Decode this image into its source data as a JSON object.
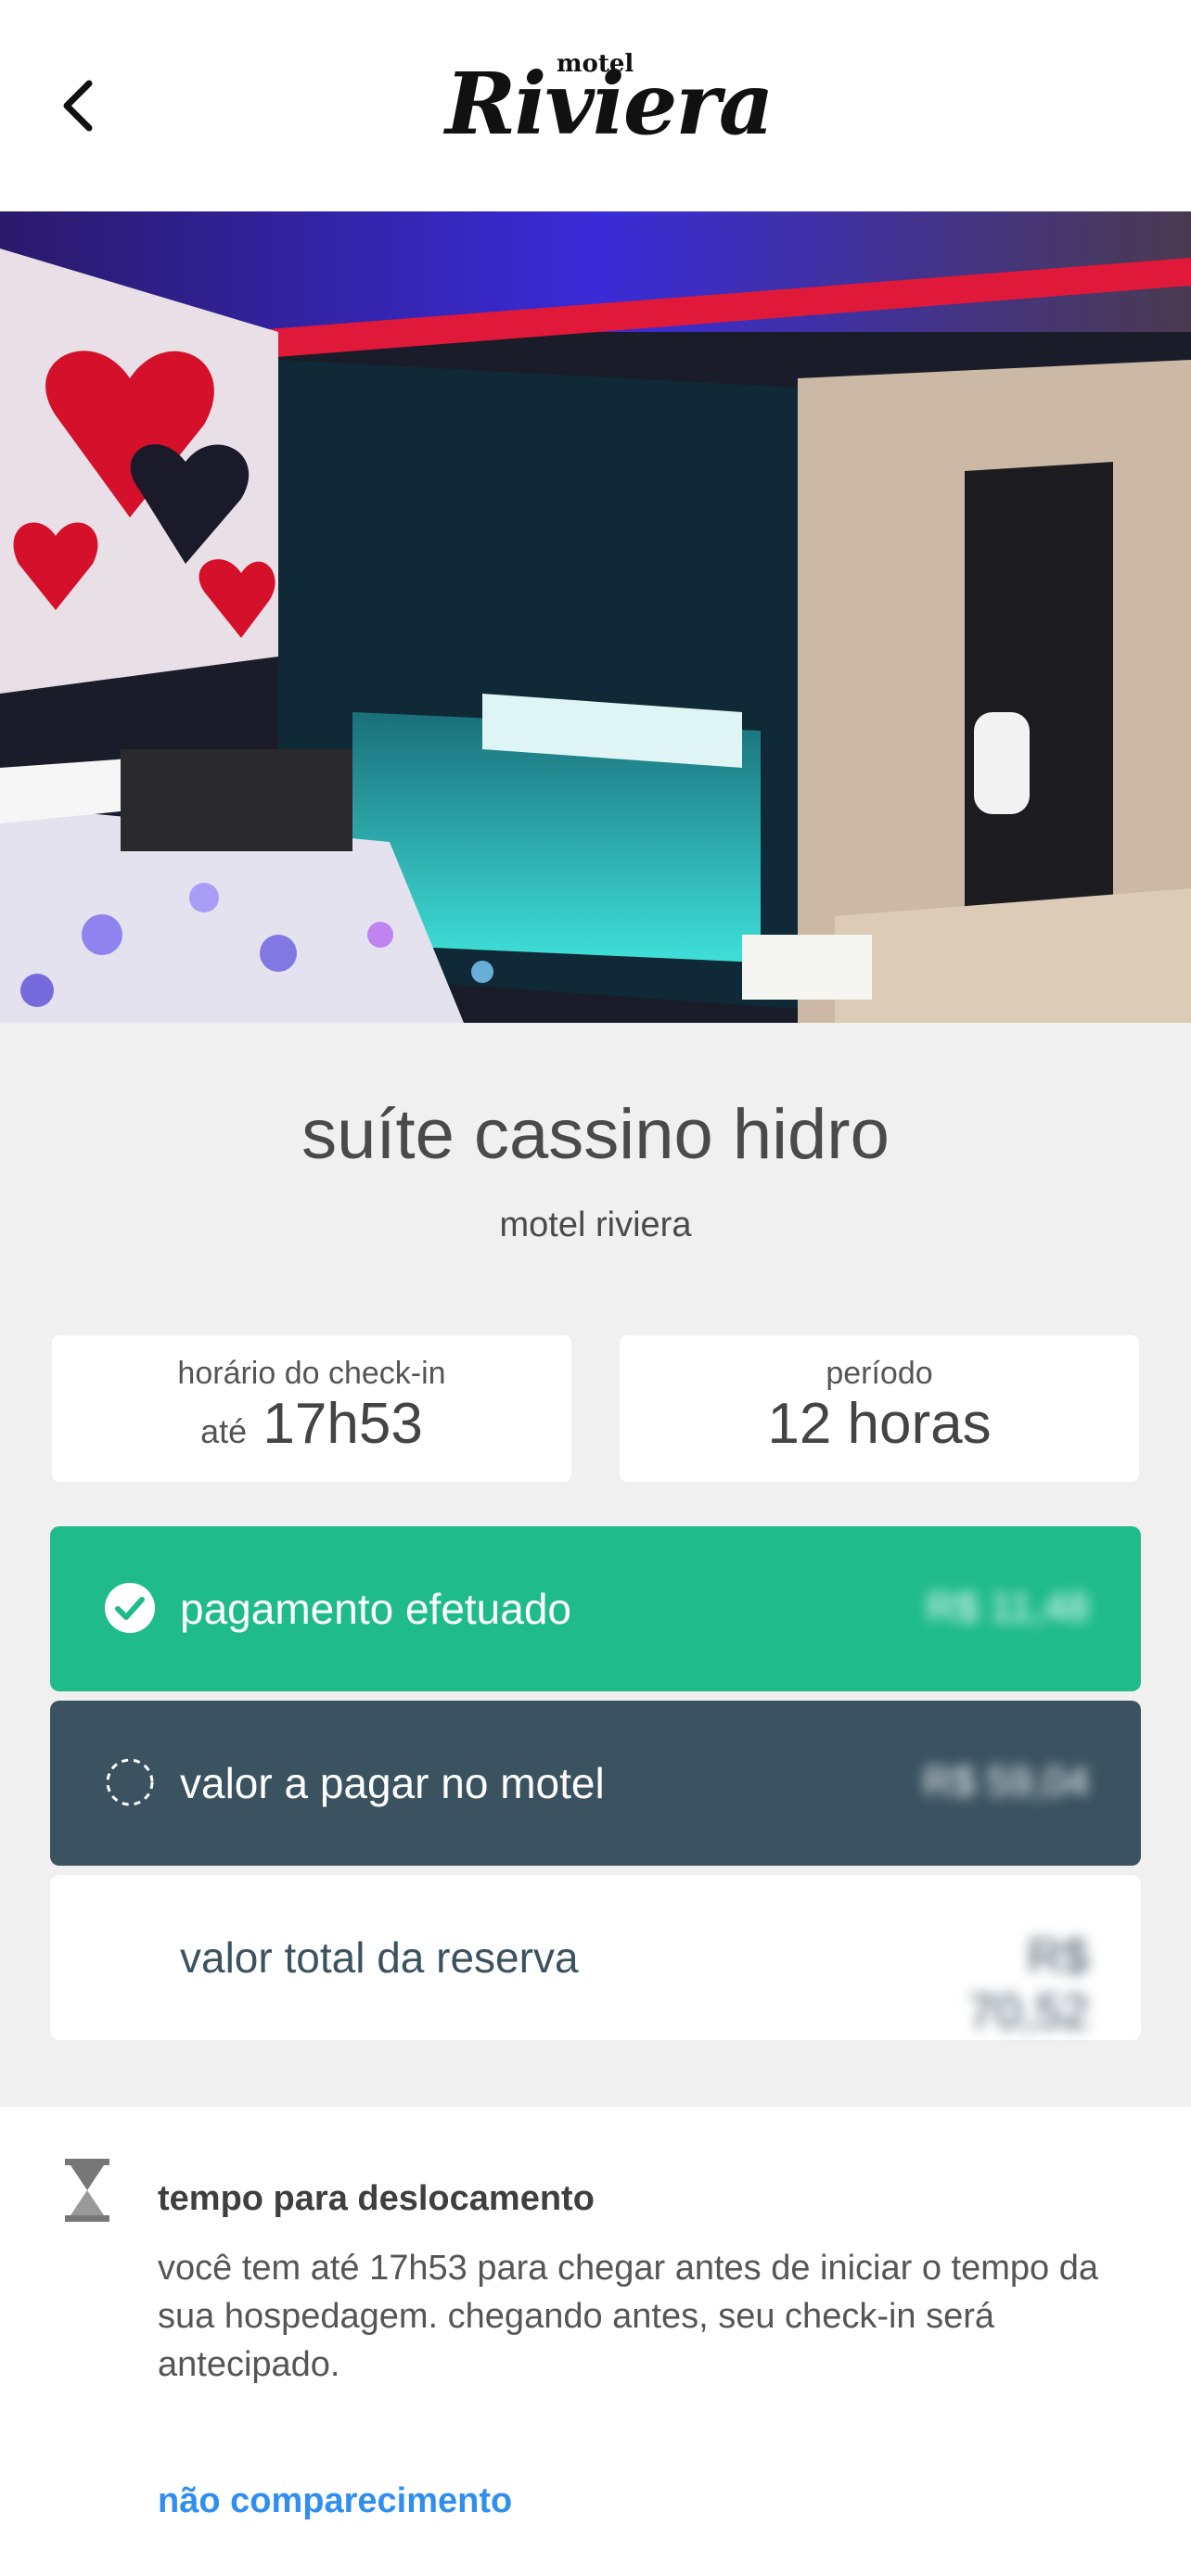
{
  "header": {
    "logo_small": "motel",
    "logo_big": "Riviera"
  },
  "suite": {
    "title": "suíte cassino hidro",
    "motel": "motel riviera"
  },
  "checkin": {
    "label": "horário do check-in",
    "prefix": "até",
    "value": "17h53"
  },
  "period": {
    "label": "período",
    "value": "12 horas"
  },
  "payments": {
    "paid_label": "pagamento efetuado",
    "paid_amount": "R$ 11,48",
    "due_label": "valor a pagar no motel",
    "due_amount": "R$ 59,04",
    "total_label": "valor total da reserva",
    "total_amount": "R$ 70,52"
  },
  "travel": {
    "title": "tempo para deslocamento",
    "text": "você tem até 17h53 para chegar antes de iniciar o tempo da sua hospedagem. chegando antes, seu check-in será antecipado.",
    "noshow_link": "não comparecimento"
  },
  "colors": {
    "paid": "#1fbb8b",
    "due": "#3b5361",
    "link": "#2f8ef0"
  }
}
